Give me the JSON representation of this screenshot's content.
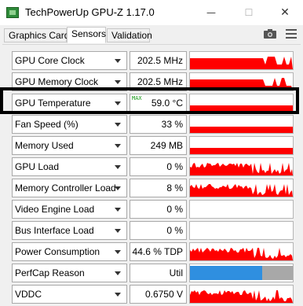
{
  "window": {
    "title": "TechPowerUp GPU-Z 1.17.0",
    "minimize": "—",
    "maximize": "☐",
    "close": "✕"
  },
  "tabs": [
    {
      "label": "Graphics Card",
      "active": false
    },
    {
      "label": "Sensors",
      "active": true
    },
    {
      "label": "Validation",
      "active": false
    }
  ],
  "toolbar": {
    "camera_icon": "camera-icon",
    "menu_icon": "hamburger-menu-icon"
  },
  "colors": {
    "graph_red": "#ff0000",
    "perfcap_blue": "#2f8fe0",
    "perfcap_gray": "#a8a8a8",
    "max_green": "#1a9a1a",
    "highlight": "#000000"
  },
  "sensors": [
    {
      "name": "GPU Core Clock",
      "value": "202.5 MHz",
      "graph": "spiky"
    },
    {
      "name": "GPU Memory Clock",
      "value": "202.5 MHz",
      "graph": "spiky"
    },
    {
      "name": "GPU Temperature",
      "value": "59.0 °C",
      "max": "MAX",
      "graph": "flat-low",
      "highlighted": true
    },
    {
      "name": "Fan Speed (%)",
      "value": "33 %",
      "graph": "flat-low"
    },
    {
      "name": "Memory Used",
      "value": "249 MB",
      "graph": "flat-low"
    },
    {
      "name": "GPU Load",
      "value": "0 %",
      "graph": "noisy"
    },
    {
      "name": "Memory Controller Load",
      "value": "8 %",
      "graph": "noisy"
    },
    {
      "name": "Video Engine Load",
      "value": "0 %",
      "graph": "empty"
    },
    {
      "name": "Bus Interface Load",
      "value": "0 %",
      "graph": "empty"
    },
    {
      "name": "Power Consumption",
      "value": "44.6 % TDP",
      "graph": "noisy"
    },
    {
      "name": "PerfCap Reason",
      "value": "Util",
      "graph": "perfcap"
    },
    {
      "name": "VDDC",
      "value": "0.6750 V",
      "graph": "noisy"
    }
  ]
}
